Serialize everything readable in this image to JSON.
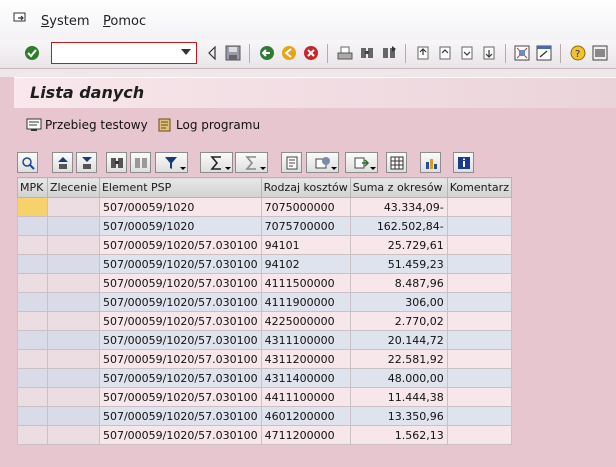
{
  "menu": {
    "items": [
      {
        "label": "System",
        "underline": "S",
        "rest": "ystem"
      },
      {
        "label": "Pomoc",
        "underline": "P",
        "rest": "omoc"
      }
    ]
  },
  "command_field": {
    "value": ""
  },
  "page": {
    "title": "Lista danych"
  },
  "app_toolbar": {
    "test_run_label": "Przebieg testowy",
    "program_log_label": "Log programu"
  },
  "table": {
    "columns": [
      "MPK",
      "Zlecenie",
      "Element PSP",
      "Rodzaj kosztów",
      "Suma z okresów",
      "Komentarz"
    ],
    "rows": [
      {
        "mpk": "",
        "zlecenie": "",
        "psp": "507/00059/1020",
        "rodzaj": "7075000000",
        "suma": "43.334,09-",
        "komentarz": ""
      },
      {
        "mpk": "",
        "zlecenie": "",
        "psp": "507/00059/1020",
        "rodzaj": "7075700000",
        "suma": "162.502,84-",
        "komentarz": ""
      },
      {
        "mpk": "",
        "zlecenie": "",
        "psp": "507/00059/1020/57.030100",
        "rodzaj": "94101",
        "suma": "25.729,61",
        "komentarz": ""
      },
      {
        "mpk": "",
        "zlecenie": "",
        "psp": "507/00059/1020/57.030100",
        "rodzaj": "94102",
        "suma": "51.459,23",
        "komentarz": ""
      },
      {
        "mpk": "",
        "zlecenie": "",
        "psp": "507/00059/1020/57.030100",
        "rodzaj": "4111500000",
        "suma": "8.487,96",
        "komentarz": ""
      },
      {
        "mpk": "",
        "zlecenie": "",
        "psp": "507/00059/1020/57.030100",
        "rodzaj": "4111900000",
        "suma": "306,00",
        "komentarz": ""
      },
      {
        "mpk": "",
        "zlecenie": "",
        "psp": "507/00059/1020/57.030100",
        "rodzaj": "4225000000",
        "suma": "2.770,02",
        "komentarz": ""
      },
      {
        "mpk": "",
        "zlecenie": "",
        "psp": "507/00059/1020/57.030100",
        "rodzaj": "4311100000",
        "suma": "20.144,72",
        "komentarz": ""
      },
      {
        "mpk": "",
        "zlecenie": "",
        "psp": "507/00059/1020/57.030100",
        "rodzaj": "4311200000",
        "suma": "22.581,92",
        "komentarz": ""
      },
      {
        "mpk": "",
        "zlecenie": "",
        "psp": "507/00059/1020/57.030100",
        "rodzaj": "4311400000",
        "suma": "48.000,00",
        "komentarz": ""
      },
      {
        "mpk": "",
        "zlecenie": "",
        "psp": "507/00059/1020/57.030100",
        "rodzaj": "4411100000",
        "suma": "11.444,38",
        "komentarz": ""
      },
      {
        "mpk": "",
        "zlecenie": "",
        "psp": "507/00059/1020/57.030100",
        "rodzaj": "4601200000",
        "suma": "13.350,96",
        "komentarz": ""
      },
      {
        "mpk": "",
        "zlecenie": "",
        "psp": "507/00059/1020/57.030100",
        "rodzaj": "4711200000",
        "suma": "1.562,13",
        "komentarz": ""
      }
    ]
  },
  "colors": {
    "background": "#e8c6cf",
    "row_light": "#f7e6ea",
    "row_blue": "#dfe3ee",
    "selected_cell": "#f5d26a",
    "command_field_border": "#c41a1a"
  }
}
